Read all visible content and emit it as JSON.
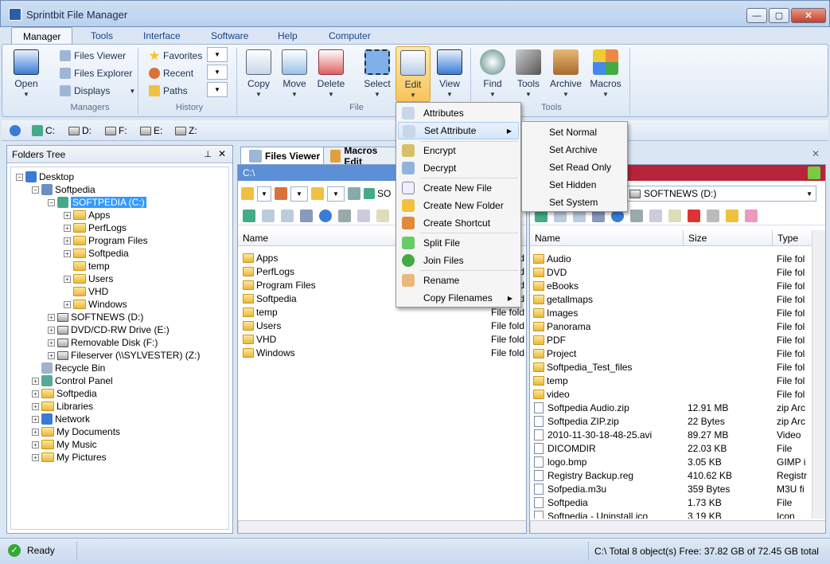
{
  "window": {
    "title": "Sprintbit File Manager"
  },
  "tabs": [
    "Manager",
    "Tools",
    "Interface",
    "Software",
    "Help",
    "Computer"
  ],
  "ribbon": {
    "open": "Open",
    "managers": {
      "items": [
        "Files Viewer",
        "Files Explorer",
        "Displays"
      ],
      "label": "Managers"
    },
    "history": {
      "items": [
        "Favorites",
        "Recent",
        "Paths"
      ],
      "label": "History"
    },
    "file": {
      "items": [
        "Copy",
        "Move",
        "Delete",
        "Select",
        "Edit",
        "View"
      ],
      "label": "File"
    },
    "tools": {
      "items": [
        "Find",
        "Tools",
        "Archive",
        "Macros"
      ],
      "label": "Tools"
    }
  },
  "drives": [
    "C:",
    "D:",
    "F:",
    "E:",
    "Z:"
  ],
  "folders_tree": {
    "title": "Folders Tree",
    "pin": "ᵖ",
    "items": [
      "Desktop",
      "Softpedia",
      "SOFTPEDIA (C:)",
      "Apps",
      "PerfLogs",
      "Program Files",
      "Softpedia",
      "temp",
      "Users",
      "VHD",
      "Windows",
      "SOFTNEWS (D:)",
      "DVD/CD-RW Drive (E:)",
      "Removable Disk (F:)",
      "Fileserver (\\\\SYLVESTER) (Z:)",
      "Recycle Bin",
      "Control Panel",
      "Softpedia",
      "Libraries",
      "Network",
      "My Documents",
      "My Music",
      "My Pictures"
    ]
  },
  "doc_tabs": [
    "Files Viewer",
    "Macros Edit"
  ],
  "left_pane": {
    "path": "C:\\",
    "drive": "SO",
    "col_name": "Name",
    "files": [
      {
        "name": "Apps",
        "type": "File fold"
      },
      {
        "name": "PerfLogs",
        "type": "File fold"
      },
      {
        "name": "Program Files",
        "type": "File fold"
      },
      {
        "name": "Softpedia",
        "type": "File fold"
      },
      {
        "name": "temp",
        "type": "File fold"
      },
      {
        "name": "Users",
        "type": "File fold"
      },
      {
        "name": "VHD",
        "type": "File fold"
      },
      {
        "name": "Windows",
        "type": "File fold"
      }
    ]
  },
  "right_pane": {
    "drive": "SOFTNEWS (D:)",
    "cols": [
      "Name",
      "Size",
      "Type"
    ],
    "files": [
      {
        "name": "Audio",
        "size": "",
        "type": "File fol"
      },
      {
        "name": "DVD",
        "size": "",
        "type": "File fol"
      },
      {
        "name": "eBooks",
        "size": "",
        "type": "File fol"
      },
      {
        "name": "getallmaps",
        "size": "",
        "type": "File fol"
      },
      {
        "name": "Images",
        "size": "",
        "type": "File fol"
      },
      {
        "name": "Panorama",
        "size": "",
        "type": "File fol"
      },
      {
        "name": "PDF",
        "size": "",
        "type": "File fol"
      },
      {
        "name": "Project",
        "size": "",
        "type": "File fol"
      },
      {
        "name": "Softpedia_Test_files",
        "size": "",
        "type": "File fol"
      },
      {
        "name": "temp",
        "size": "",
        "type": "File fol"
      },
      {
        "name": "video",
        "size": "",
        "type": "File fol"
      },
      {
        "name": "Softpedia Audio.zip",
        "size": "12.91 MB",
        "type": "zip Arc"
      },
      {
        "name": "Softpedia ZIP.zip",
        "size": "22 Bytes",
        "type": "zip Arc"
      },
      {
        "name": "2010-11-30-18-48-25.avi",
        "size": "89.27 MB",
        "type": "Video"
      },
      {
        "name": "DICOMDIR",
        "size": "22.03 KB",
        "type": "File"
      },
      {
        "name": "logo.bmp",
        "size": "3.05 KB",
        "type": "GIMP i"
      },
      {
        "name": "Registry Backup.reg",
        "size": "410.62 KB",
        "type": "Registr"
      },
      {
        "name": "Sofpedia.m3u",
        "size": "359 Bytes",
        "type": "M3U fi"
      },
      {
        "name": "Softpedia",
        "size": "1.73 KB",
        "type": "File"
      },
      {
        "name": "Softpedia - Uninstall.ico",
        "size": "3.19 KB",
        "type": "Icon"
      }
    ]
  },
  "context_menu": [
    "Attributes",
    "Set Attribute",
    "Encrypt",
    "Decrypt",
    "Create New File",
    "Create New Folder",
    "Create Shortcut",
    "Split File",
    "Join Files",
    "Rename",
    "Copy Filenames"
  ],
  "submenu": [
    "Set Normal",
    "Set Archive",
    "Set Read Only",
    "Set Hidden",
    "Set System"
  ],
  "status": {
    "left": "Ready",
    "right": "C:\\ Total 8 object(s) Free: 37.82 GB of 72.45 GB total"
  },
  "colors": {
    "left_path": "#5b8fd6",
    "right_path": "#b5243a",
    "selection": "#3399ff"
  }
}
